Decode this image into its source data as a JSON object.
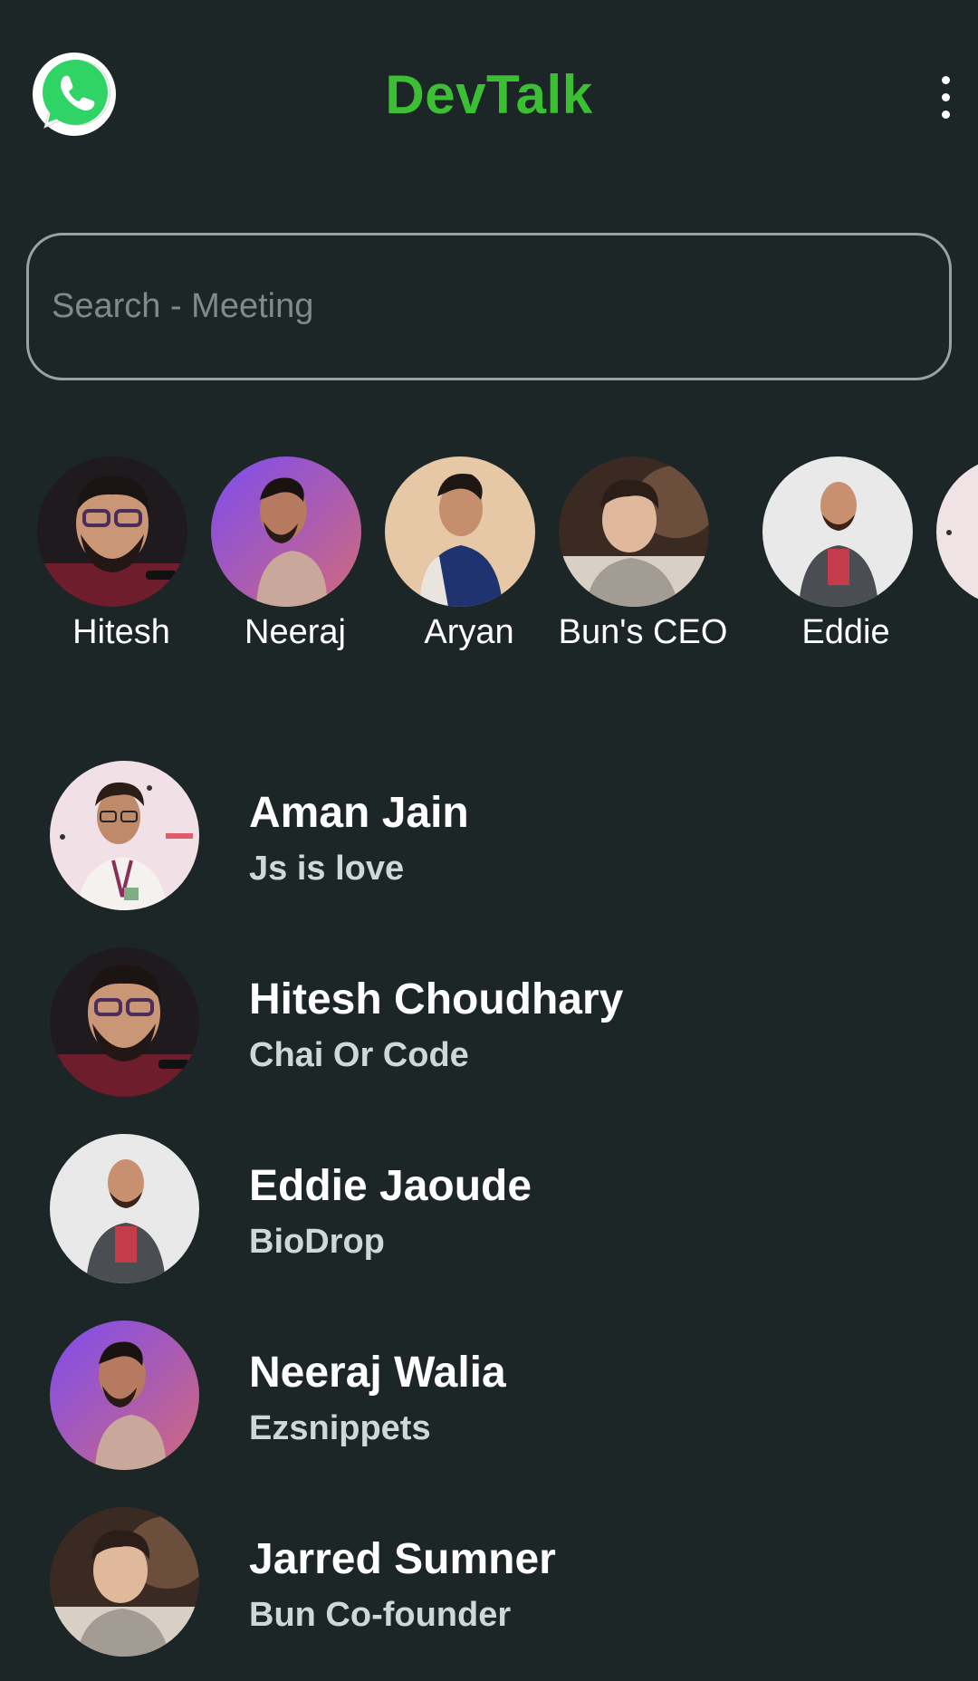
{
  "app": {
    "title": "DevTalk",
    "accent": "#3dbf35",
    "background": "#1c2626"
  },
  "header": {
    "logo_icon": "whatsapp-logo-icon",
    "menu_icon": "more-vert-icon"
  },
  "search": {
    "placeholder": "Search - Meeting",
    "value": ""
  },
  "stories": [
    {
      "name": "Hitesh"
    },
    {
      "name": "Neeraj"
    },
    {
      "name": "Aryan"
    },
    {
      "name": "Bun's CEO"
    },
    {
      "name": "Eddie"
    }
  ],
  "chats": [
    {
      "name": "Aman Jain",
      "message": "Js is love"
    },
    {
      "name": "Hitesh Choudhary",
      "message": "Chai Or Code"
    },
    {
      "name": "Eddie Jaoude",
      "message": "BioDrop"
    },
    {
      "name": "Neeraj Walia",
      "message": "Ezsnippets"
    },
    {
      "name": "Jarred Sumner",
      "message": "Bun Co-founder"
    }
  ]
}
